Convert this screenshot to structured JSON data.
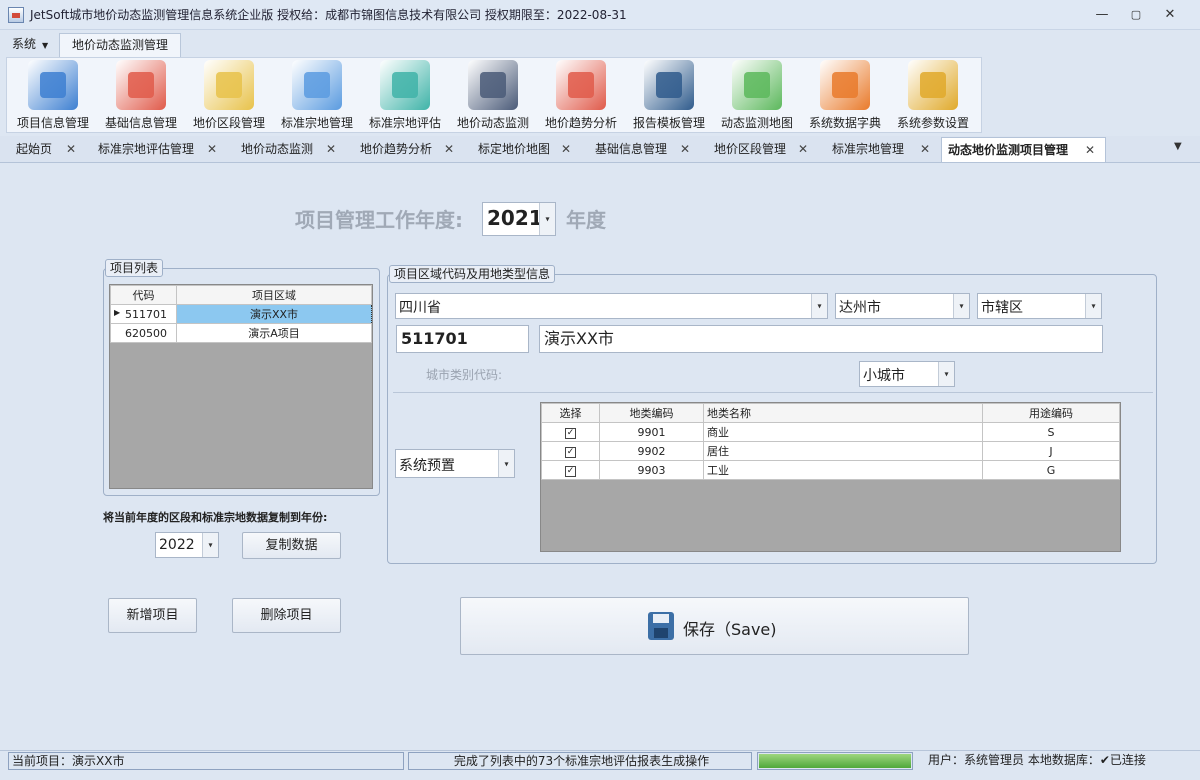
{
  "window": {
    "title": "JetSoft城市地价动态监测管理信息系统企业版   授权给：成都市锦图信息技术有限公司   授权期限至：2022-08-31",
    "min": "—",
    "max": "▢",
    "close": "✕"
  },
  "menu": {
    "system": "系统",
    "active_tab": "地价动态监测管理"
  },
  "ribbon": [
    {
      "label": "项目信息管理",
      "icon": "project-info-icon",
      "color": "#3d7fd1"
    },
    {
      "label": "基础信息管理",
      "icon": "clipboard-icon",
      "color": "#e05a4a"
    },
    {
      "label": "地价区段管理",
      "icon": "map-search-icon",
      "color": "#e8c24a"
    },
    {
      "label": "标准宗地管理",
      "icon": "map-pin-icon",
      "color": "#5a9be0"
    },
    {
      "label": "标准宗地评估",
      "icon": "house-eval-icon",
      "color": "#3fb3a8"
    },
    {
      "label": "地价动态监测",
      "icon": "monitor-chart-icon",
      "color": "#4a5a78"
    },
    {
      "label": "地价趋势分析",
      "icon": "trend-chart-icon",
      "color": "#e05a4a"
    },
    {
      "label": "报告模板管理",
      "icon": "laptop-icon",
      "color": "#2f5b8c"
    },
    {
      "label": "动态监测地图",
      "icon": "map-magnify-icon",
      "color": "#5cb85c"
    },
    {
      "label": "系统数据字典",
      "icon": "dictionary-icon",
      "color": "#e97a2b"
    },
    {
      "label": "系统参数设置",
      "icon": "gear-icon",
      "color": "#e0a92a"
    }
  ],
  "doc_tabs": [
    {
      "label": "起始页"
    },
    {
      "label": "标准宗地评估管理"
    },
    {
      "label": "地价动态监测"
    },
    {
      "label": "地价趋势分析"
    },
    {
      "label": "标定地价地图"
    },
    {
      "label": "基础信息管理"
    },
    {
      "label": "地价区段管理"
    },
    {
      "label": "标准宗地管理"
    },
    {
      "label": "动态地价监测项目管理"
    }
  ],
  "year": {
    "label": "项目管理工作年度:",
    "value": "2021",
    "suffix": "年度"
  },
  "project_list": {
    "title": "项目列表",
    "headers": [
      "代码",
      "项目区域"
    ],
    "rows": [
      {
        "marker": "▶",
        "code": "511701",
        "region": "演示XX市"
      },
      {
        "marker": "",
        "code": "620500",
        "region": "演示A项目"
      }
    ]
  },
  "copy": {
    "label": "将当前年度的区段和标准宗地数据复制到年份:",
    "year": "2022",
    "button": "复制数据"
  },
  "region_info": {
    "title": "项目区域代码及用地类型信息",
    "province": "四川省",
    "city": "达州市",
    "district": "市辖区",
    "code": "511701",
    "name": "演示XX市",
    "city_type_label": "城市类别代码:",
    "city_type": "小城市",
    "preset": "系统预置"
  },
  "landuse": {
    "headers": [
      "选择",
      "地类编码",
      "地类名称",
      "用途编码"
    ],
    "rows": [
      {
        "checked": "✓",
        "code": "9901",
        "name": "商业",
        "use": "S"
      },
      {
        "checked": "✓",
        "code": "9902",
        "name": "居住",
        "use": "J"
      },
      {
        "checked": "✓",
        "code": "9903",
        "name": "工业",
        "use": "G"
      }
    ]
  },
  "buttons": {
    "add": "新增项目",
    "delete": "删除项目",
    "save": "保存（Save)"
  },
  "status": {
    "project": "当前项目：演示XX市",
    "message": "完成了列表中的73个标准宗地评估报表生成操作",
    "progress": 1.0,
    "user": "用户：系统管理员  本地数据库：",
    "connected": "✔已连接"
  }
}
